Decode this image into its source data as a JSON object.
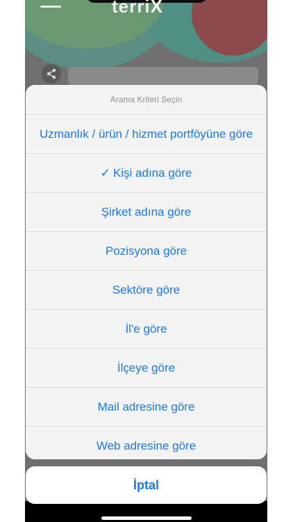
{
  "app": {
    "logo_text": "terri",
    "logo_mark": "X"
  },
  "action_sheet": {
    "title": "Arama Kriteri Seçin",
    "options": [
      {
        "label": "Uzmanlık / ürün / hizmet portföyüne göre",
        "selected": false
      },
      {
        "label": "Kişi adına göre",
        "selected": true
      },
      {
        "label": "Şirket adına göre",
        "selected": false
      },
      {
        "label": "Pozisyona göre",
        "selected": false
      },
      {
        "label": "Sektöre göre",
        "selected": false
      },
      {
        "label": "İl'e göre",
        "selected": false
      },
      {
        "label": "İlçeye göre",
        "selected": false
      },
      {
        "label": "Mail adresine göre",
        "selected": false
      },
      {
        "label": "Web adresine göre",
        "selected": false
      }
    ],
    "check_mark": "✓",
    "cancel_label": "İptal"
  },
  "colors": {
    "accent": "#1a78e6",
    "sheet_bg": "#f4f4f4",
    "dim_bg": "#6f6f70"
  },
  "icons": [
    "menu-icon",
    "share-icon"
  ]
}
